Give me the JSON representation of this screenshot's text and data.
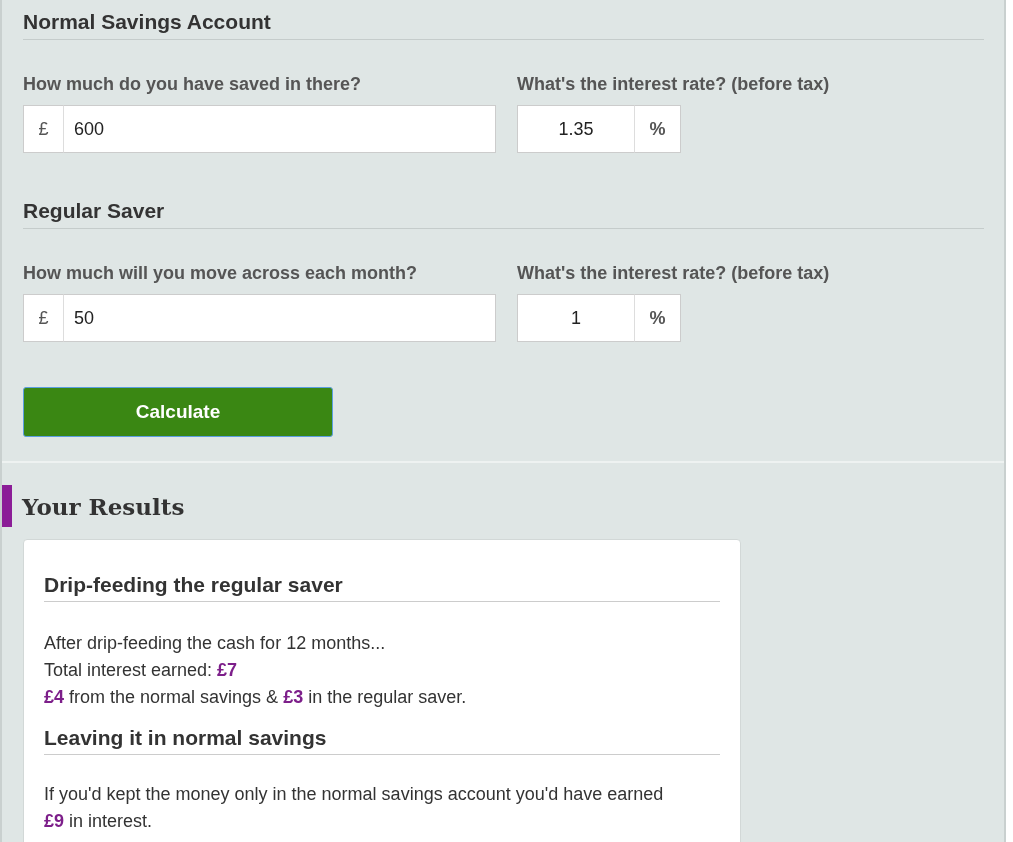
{
  "sections": [
    {
      "title": "Normal Savings Account",
      "fields": [
        {
          "label": "How much do you have saved in there?",
          "prefix": "£",
          "value": "600"
        },
        {
          "label": "What's the interest rate? (before tax)",
          "value": "1.35",
          "suffix": "%"
        }
      ]
    },
    {
      "title": "Regular Saver",
      "fields": [
        {
          "label": "How much will you move across each month?",
          "prefix": "£",
          "value": "50"
        },
        {
          "label": "What's the interest rate? (before tax)",
          "value": "1",
          "suffix": "%"
        }
      ]
    }
  ],
  "button": "Calculate",
  "results": {
    "title": "Your Results",
    "blocks": [
      {
        "heading": "Drip-feeding the regular saver",
        "paragraphs": [
          "After drip-feeding the cash for 12 months...",
          "Total interest earned: **£7**",
          "**£4** from the normal savings & **£3** in the regular saver."
        ]
      },
      {
        "heading": "Leaving it in normal savings",
        "paragraphs": [
          "If you'd kept the money only in the normal savings account you'd have earned **£9** in interest."
        ]
      }
    ]
  }
}
